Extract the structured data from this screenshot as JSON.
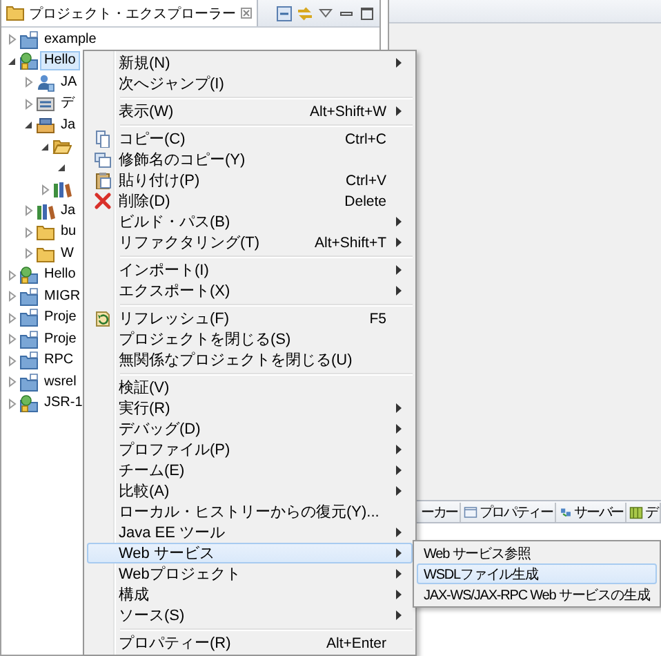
{
  "explorer": {
    "title": "プロジェクト・エクスプローラー",
    "tree": [
      {
        "label": "example",
        "kind": "project",
        "expanded": false,
        "selected": false
      },
      {
        "label": "Hello",
        "kind": "webproject",
        "expanded": true,
        "selected": true,
        "children": [
          {
            "label": "JA",
            "kind": "service",
            "expanded": false,
            "selected": false
          },
          {
            "label": "デ",
            "kind": "deploy",
            "expanded": false,
            "selected": false
          },
          {
            "label": "Ja",
            "kind": "jar",
            "expanded": true,
            "selected": false,
            "children": [
              {
                "kind": "package",
                "expanded": true,
                "selected": false,
                "children": [
                  {
                    "expanded": true,
                    "selected": false
                  }
                ]
              },
              {
                "kind": "library",
                "expanded": false,
                "selected": false
              }
            ]
          },
          {
            "label": "Ja",
            "kind": "library",
            "expanded": false,
            "selected": false
          },
          {
            "label": "bu",
            "kind": "folder",
            "expanded": false,
            "selected": false
          },
          {
            "label": "W",
            "kind": "folder",
            "expanded": false,
            "selected": false
          }
        ]
      },
      {
        "label": "Hello",
        "kind": "webproject",
        "expanded": false,
        "selected": false
      },
      {
        "label": "MIGR",
        "kind": "project",
        "expanded": false,
        "selected": false
      },
      {
        "label": "Proje",
        "kind": "project",
        "expanded": false,
        "selected": false
      },
      {
        "label": "Proje",
        "kind": "project",
        "expanded": false,
        "selected": false
      },
      {
        "label": "RPC",
        "kind": "project",
        "expanded": false,
        "selected": false
      },
      {
        "label": "wsrel",
        "kind": "project",
        "expanded": false,
        "selected": false
      },
      {
        "label": "JSR-1",
        "kind": "webproject",
        "expanded": false,
        "selected": false
      }
    ]
  },
  "editor_area": {
    "bottom_tabs": [
      {
        "label": "ーカー"
      },
      {
        "label": "プロパティー",
        "kind": "properties"
      },
      {
        "label": "サーバー",
        "kind": "servers"
      },
      {
        "label": "デ",
        "kind": "data"
      }
    ]
  },
  "context_menu": {
    "groups": [
      {
        "items": [
          {
            "label": "新規(N)",
            "has_submenu": true,
            "selected": false
          },
          {
            "label": "次へジャンプ(I)",
            "has_submenu": false,
            "selected": false
          }
        ]
      },
      {
        "items": [
          {
            "label": "表示(W)",
            "shortcut": "Alt+Shift+W",
            "has_submenu": true,
            "selected": false
          }
        ]
      },
      {
        "items": [
          {
            "label": "コピー(C)",
            "shortcut": "Ctrl+C",
            "kind": "copy",
            "has_submenu": false,
            "selected": false
          },
          {
            "label": "修飾名のコピー(Y)",
            "kind": "copy-qualified",
            "has_submenu": false,
            "selected": false
          },
          {
            "label": "貼り付け(P)",
            "shortcut": "Ctrl+V",
            "kind": "paste",
            "has_submenu": false,
            "selected": false
          },
          {
            "label": "削除(D)",
            "shortcut": "Delete",
            "kind": "delete",
            "has_submenu": false,
            "selected": false
          },
          {
            "label": "ビルド・パス(B)",
            "has_submenu": true,
            "selected": false
          },
          {
            "label": "リファクタリング(T)",
            "shortcut": "Alt+Shift+T",
            "has_submenu": true,
            "selected": false
          }
        ]
      },
      {
        "items": [
          {
            "label": "インポート(I)",
            "has_submenu": true,
            "selected": false
          },
          {
            "label": "エクスポート(X)",
            "has_submenu": true,
            "selected": false
          }
        ]
      },
      {
        "items": [
          {
            "label": "リフレッシュ(F)",
            "shortcut": "F5",
            "kind": "refresh",
            "has_submenu": false,
            "selected": false
          },
          {
            "label": "プロジェクトを閉じる(S)",
            "has_submenu": false,
            "selected": false
          },
          {
            "label": "無関係なプロジェクトを閉じる(U)",
            "has_submenu": false,
            "selected": false
          }
        ]
      },
      {
        "items": [
          {
            "label": "検証(V)",
            "has_submenu": false,
            "selected": false
          },
          {
            "label": "実行(R)",
            "has_submenu": true,
            "selected": false
          },
          {
            "label": "デバッグ(D)",
            "has_submenu": true,
            "selected": false
          },
          {
            "label": "プロファイル(P)",
            "has_submenu": true,
            "selected": false
          },
          {
            "label": "チーム(E)",
            "has_submenu": true,
            "selected": false
          },
          {
            "label": "比較(A)",
            "has_submenu": true,
            "selected": false
          },
          {
            "label": "ローカル・ヒストリーからの復元(Y)...",
            "has_submenu": false,
            "selected": false
          },
          {
            "label": "Java EE ツール",
            "has_submenu": true,
            "selected": false
          },
          {
            "label": "Web サービス",
            "has_submenu": true,
            "selected": true,
            "submenu": [
              {
                "label": "Web サービス参照",
                "selected": false
              },
              {
                "label": "WSDLファイル生成",
                "selected": true
              },
              {
                "label": "JAX-WS/JAX-RPC Web サービスの生成",
                "selected": false
              }
            ]
          },
          {
            "label": "Webプロジェクト",
            "has_submenu": true,
            "selected": false
          },
          {
            "label": "構成",
            "has_submenu": true,
            "selected": false
          },
          {
            "label": "ソース(S)",
            "has_submenu": true,
            "selected": false
          }
        ]
      },
      {
        "items": [
          {
            "label": "プロパティー(R)",
            "shortcut": "Alt+Enter",
            "has_submenu": false,
            "selected": false
          }
        ]
      }
    ]
  }
}
